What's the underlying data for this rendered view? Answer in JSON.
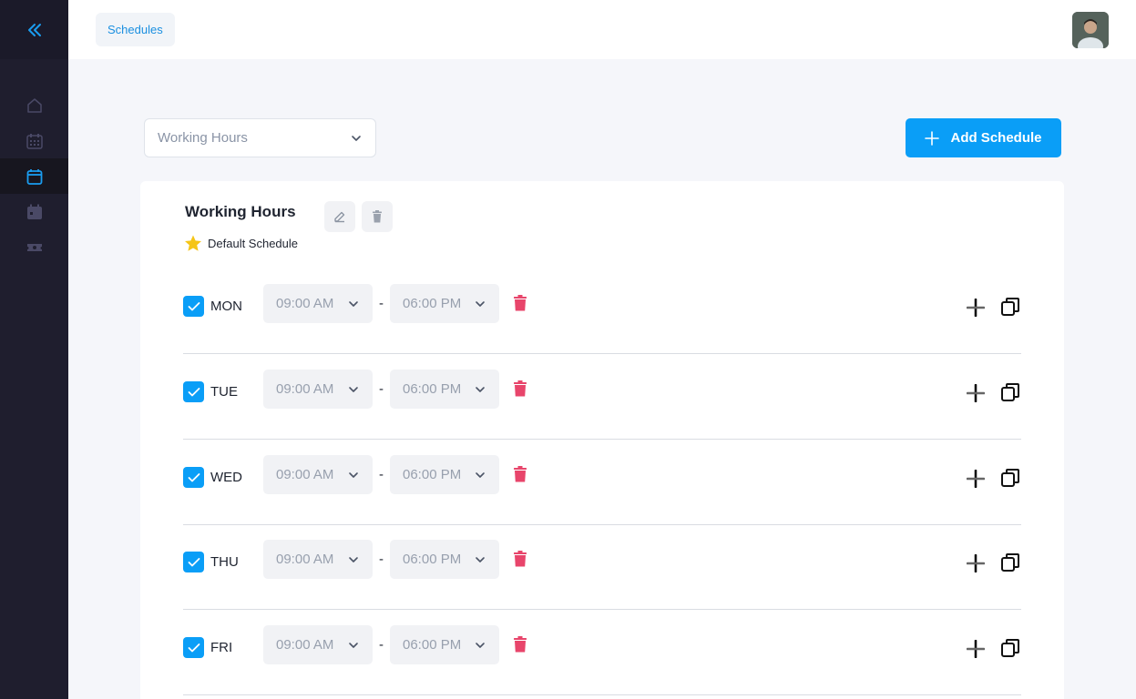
{
  "breadcrumb": {
    "label": "Schedules"
  },
  "schedule_select": {
    "value": "Working Hours"
  },
  "add_schedule": {
    "label": "Add Schedule"
  },
  "schedule": {
    "title": "Working Hours",
    "default_label": "Default Schedule",
    "days": [
      {
        "day": "MON",
        "start": "09:00 AM",
        "end": "06:00 PM",
        "enabled": true
      },
      {
        "day": "TUE",
        "start": "09:00 AM",
        "end": "06:00 PM",
        "enabled": true
      },
      {
        "day": "WED",
        "start": "09:00 AM",
        "end": "06:00 PM",
        "enabled": true
      },
      {
        "day": "THU",
        "start": "09:00 AM",
        "end": "06:00 PM",
        "enabled": true
      },
      {
        "day": "FRI",
        "start": "09:00 AM",
        "end": "06:00 PM",
        "enabled": true
      }
    ],
    "separator": "-"
  },
  "colors": {
    "accent": "#0a9ef7",
    "danger": "#e8456b",
    "star": "#f5c518",
    "sidebar": "#1f1e2e"
  },
  "icons": [
    "chevrons-left-icon",
    "home-icon",
    "calendar-grid-icon",
    "calendar-icon",
    "calendar-filled-icon",
    "ticket-icon",
    "edit-icon",
    "trash-icon",
    "star-icon",
    "plus-icon",
    "copy-icon",
    "chevron-down-icon",
    "check-icon"
  ]
}
